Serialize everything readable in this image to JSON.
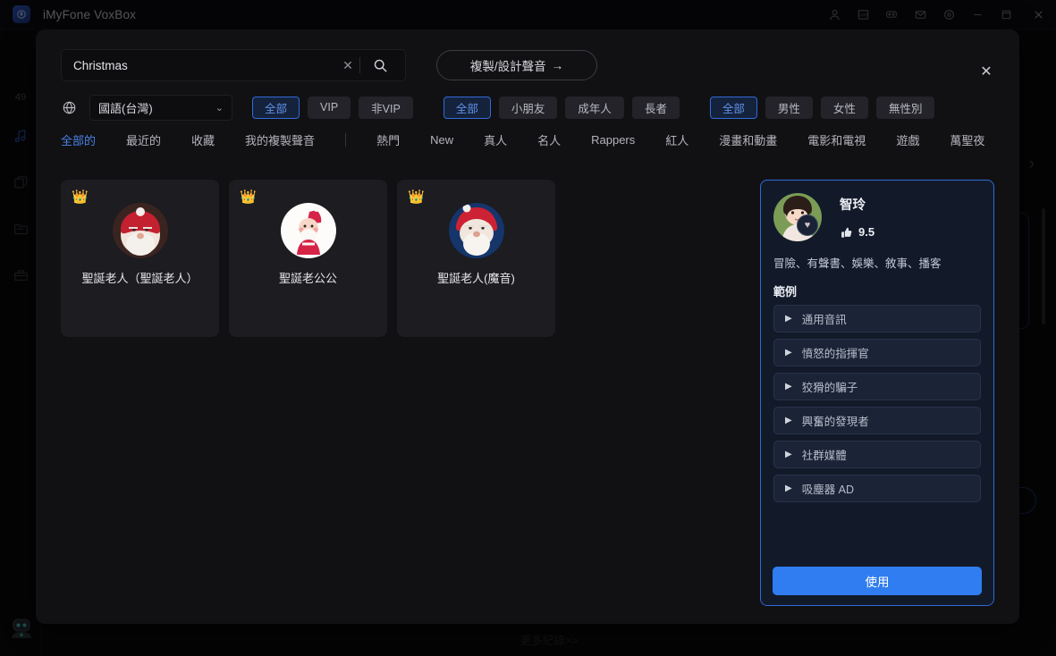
{
  "titlebar": {
    "app_title": "iMyFone VoxBox",
    "logo_icon": "voxbox-logo",
    "icons": [
      {
        "name": "account-icon",
        "glyph": "person"
      },
      {
        "name": "app-store-icon",
        "glyph": "app"
      },
      {
        "name": "discord-icon",
        "glyph": "controller"
      },
      {
        "name": "mail-icon",
        "glyph": "envelope"
      },
      {
        "name": "settings-icon",
        "glyph": "target"
      },
      {
        "name": "minimize-icon",
        "glyph": "minus"
      },
      {
        "name": "maximize-icon",
        "glyph": "square"
      },
      {
        "name": "close-icon",
        "glyph": "x"
      }
    ]
  },
  "rail": {
    "count_label": "49",
    "items": [
      {
        "name": "sidebar-text-to-speech",
        "icon": "music-note-icon",
        "active": true
      },
      {
        "name": "sidebar-voice-clone",
        "icon": "layers-icon",
        "active": false
      },
      {
        "name": "sidebar-files",
        "icon": "folder-icon",
        "active": false
      },
      {
        "name": "sidebar-toolbox",
        "icon": "toolbox-icon",
        "active": false
      }
    ],
    "bot_icon": "robot-assistant-icon"
  },
  "background": {
    "more_records_label": "更多紀錄>>",
    "next_chevron": "›"
  },
  "search": {
    "value": "Christmas",
    "placeholder": "Christmas",
    "clear_label": "✕",
    "search_icon": "search-icon",
    "clone_button_label": "複製/設計聲音",
    "clone_button_arrow": "→"
  },
  "modal": {
    "close_label": "✕"
  },
  "filters": {
    "globe_icon": "globe-icon",
    "language": {
      "value": "國語(台灣)",
      "chevron": "⌄"
    },
    "groups": [
      {
        "name": "membership",
        "options": [
          {
            "label": "全部",
            "active": true
          },
          {
            "label": "VIP",
            "active": false
          },
          {
            "label": "非VIP",
            "active": false
          }
        ]
      },
      {
        "name": "age",
        "options": [
          {
            "label": "全部",
            "active": true
          },
          {
            "label": "小朋友",
            "active": false
          },
          {
            "label": "成年人",
            "active": false
          },
          {
            "label": "長者",
            "active": false
          }
        ]
      },
      {
        "name": "gender",
        "options": [
          {
            "label": "全部",
            "active": true
          },
          {
            "label": "男性",
            "active": false
          },
          {
            "label": "女性",
            "active": false
          },
          {
            "label": "無性別",
            "active": false
          }
        ]
      }
    ]
  },
  "tabs": {
    "left": [
      {
        "label": "全部的",
        "active": true
      },
      {
        "label": "最近的",
        "active": false
      },
      {
        "label": "收藏",
        "active": false
      },
      {
        "label": "我的複製聲音",
        "active": false
      }
    ],
    "right": [
      {
        "label": "熱門",
        "active": false
      },
      {
        "label": "New",
        "active": false
      },
      {
        "label": "真人",
        "active": false
      },
      {
        "label": "名人",
        "active": false
      },
      {
        "label": "Rappers",
        "active": false
      },
      {
        "label": "紅人",
        "active": false
      },
      {
        "label": "漫畫和動畫",
        "active": false
      },
      {
        "label": "電影和電視",
        "active": false
      },
      {
        "label": "遊戲",
        "active": false
      },
      {
        "label": "萬聖夜",
        "active": false
      }
    ]
  },
  "cards": [
    {
      "name": "聖誕老人（聖誕老人）",
      "vip": true,
      "crown": "👑",
      "avatar": "santa-photo-realistic"
    },
    {
      "name": "聖誕老公公",
      "vip": true,
      "crown": "👑",
      "avatar": "santa-illustration-white"
    },
    {
      "name": "聖誕老人(魔音)",
      "vip": true,
      "crown": "👑",
      "avatar": "santa-blue-background"
    }
  ],
  "detail": {
    "name": "智玲",
    "avatar": "female-portrait",
    "favorite_icon": "heart-icon",
    "rating_icon": "thumbs-up-icon",
    "rating": "9.5",
    "tags": "冒險、有聲書、娛樂、敘事、播客",
    "samples_heading": "範例",
    "samples": [
      {
        "label": "通用音訊",
        "icon": "play-icon"
      },
      {
        "label": "憤怒的指揮官",
        "icon": "play-icon"
      },
      {
        "label": "狡猾的騙子",
        "icon": "play-icon"
      },
      {
        "label": "興奮的發現者",
        "icon": "play-icon"
      },
      {
        "label": "社群媒體",
        "icon": "play-icon"
      },
      {
        "label": "吸塵器 AD",
        "icon": "play-icon"
      }
    ],
    "use_button_label": "使用"
  },
  "colors": {
    "accent_blue": "#2f7df0",
    "active_pill_blue": "#5f92e8",
    "panel_bg": "#121a2a",
    "modal_bg": "#111114",
    "card_bg": "#1c1c21"
  }
}
